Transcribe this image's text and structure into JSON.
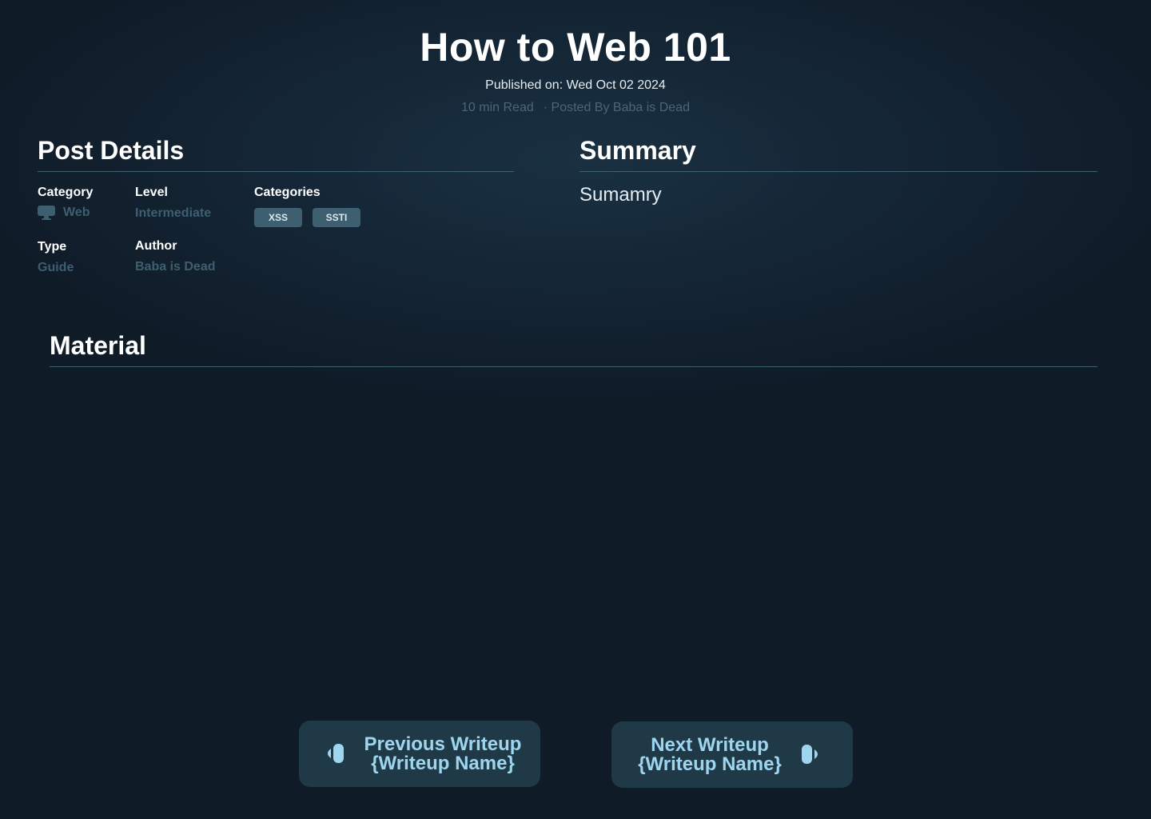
{
  "header": {
    "title": "How to Web 101",
    "published": "Published on: Wed Oct 02 2024",
    "read_time": "10 min Read",
    "posted_by": "· Posted By Baba is Dead"
  },
  "post_details": {
    "heading": "Post Details",
    "category_label": "Category",
    "category_value": "Web",
    "category_icon": "monitor-icon",
    "level_label": "Level",
    "level_value": "Intermediate",
    "categories_label": "Categories",
    "tags": [
      "XSS",
      "SSTI"
    ],
    "type_label": "Type",
    "type_value": "Guide",
    "author_label": "Author",
    "author_value": "Baba is Dead"
  },
  "summary": {
    "heading": "Summary",
    "text": "Sumamry"
  },
  "material": {
    "heading": "Material"
  },
  "navigation": {
    "prev_line1": "Previous Writeup",
    "prev_line2": "{Writeup Name}",
    "prev_icon": "arrow-left-icon",
    "next_line1": "Next Writeup",
    "next_line2": "{Writeup Name}",
    "next_icon": "arrow-right-icon"
  },
  "colors": {
    "background": "#101b28",
    "accent_muted": "#3e5f70",
    "button_bg": "#203946",
    "button_text": "#9ed6f0"
  }
}
